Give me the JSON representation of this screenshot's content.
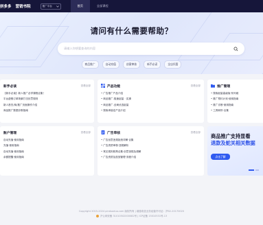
{
  "nav": {
    "brand": "拼多多",
    "brand_sub": "营销书院",
    "select_value": "推广平台",
    "tabs": [
      {
        "label": "首页",
        "active": true
      },
      {
        "label": "全部课程",
        "active": false
      }
    ]
  },
  "hero": {
    "title": "请问有什么需要帮助？",
    "search_placeholder": "请输入你想要查询的内容",
    "quick_tags": [
      "商品推广",
      "自动充值",
      "创意审核",
      "新手必读",
      "全店托管"
    ]
  },
  "cards": [
    {
      "title": "新手必读",
      "more": "查看全部",
      "icon_color": "#2f5af0",
      "items": [
        "【新手必读】新人推广必学课程合集！",
        "平台虚假订单场景打击处罚规则",
        "新人首充/商/推广页面操作介绍",
        "商品推广数据诊断指南"
      ]
    },
    {
      "title": "产品功能",
      "more": "查看全部",
      "icon_color": "#2f5af0",
      "items": [
        "• 广告推广产品介绍",
        "• 商品推广-极速起量 · 实操",
        "• 商品推广-全局优选起量",
        "• 搜索承接定产品介绍"
      ]
    },
    {
      "title": "推广管理",
      "more": "",
      "icon_color": "#2f5af0",
      "items": [
        "• 搜索起量高级版·系列维",
        "• 推广预约计划·使用指南",
        "• 推广诊断·使用指南",
        "• 工具和所·合集"
      ]
    },
    {
      "title": "账户管理",
      "more": "查看全部",
      "icon_color": "#2f5af0",
      "items": [
        "自动充值·使用指南",
        "充值·使用指南",
        "自动充值·使用指南",
        "余额提醒·使用指南"
      ]
    },
    {
      "title": "广告审核",
      "more": "查看全部",
      "icon_color": "#2f5af0",
      "items": [
        "• 广告创意违规拒绝详解·合集",
        "• 广告资质审核·违规解析",
        "• 常见规则政策合集·创意违规及调解",
        "• 广告资质及投放管理·流程介绍"
      ]
    }
  ],
  "promo": {
    "line1": "商品推广支持显看",
    "line2": "退款及蛇关相关数据",
    "button": "点击了解"
  },
  "footer": {
    "line1": "Copyright 2015-2024 pinduoduo.com 版权所有 | 增值电信业务经营许可证：沪B2-20170020",
    "line2": "沪公网安备 31010502000082号 | ICP证备 15010531号-13"
  }
}
